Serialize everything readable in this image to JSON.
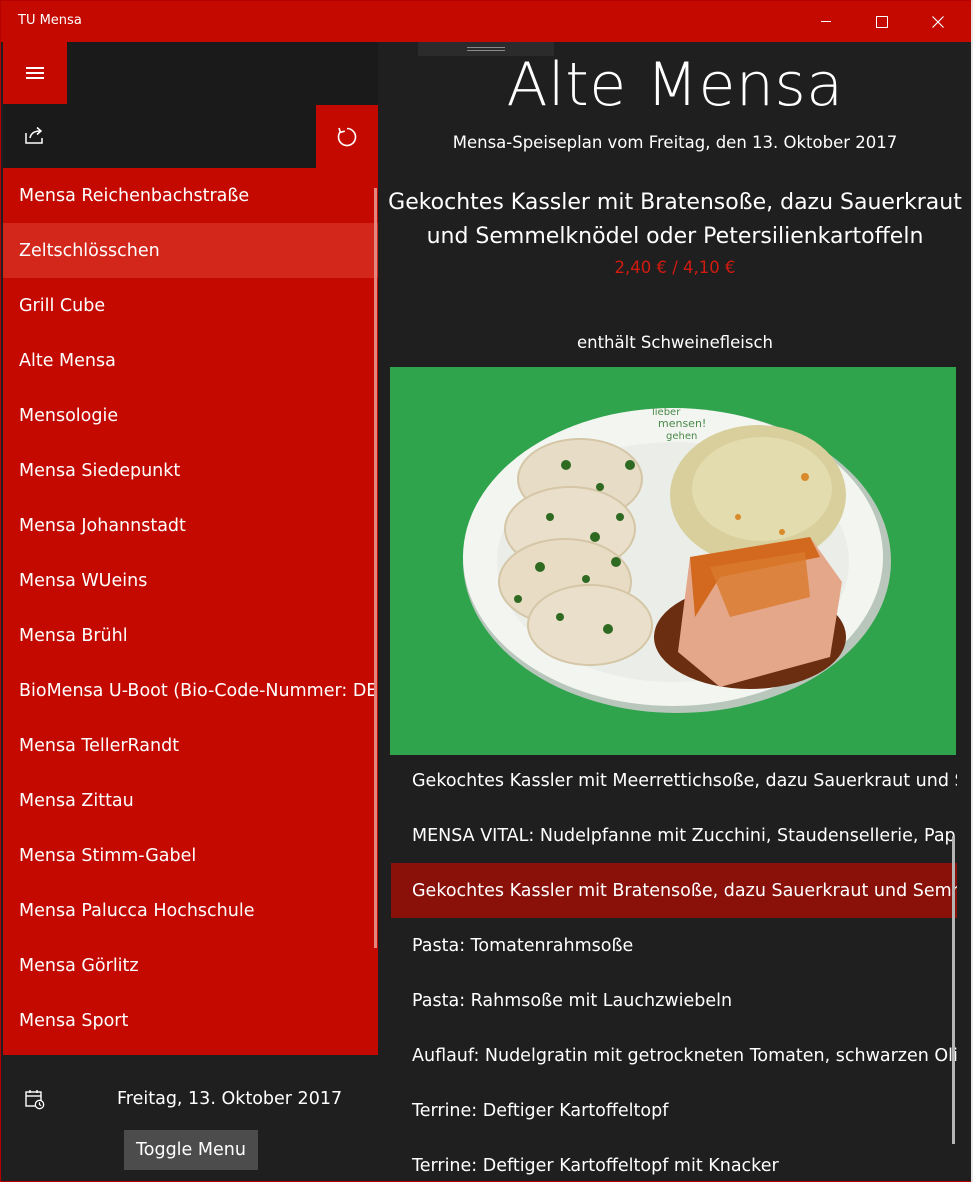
{
  "window": {
    "title": "TU Mensa",
    "accent_color": "#c40a00",
    "controls": [
      "minimize-icon",
      "maximize-icon",
      "close-icon"
    ]
  },
  "pane": {
    "menu_icon": "hamburger-icon",
    "share_icon": "share-icon",
    "refresh_icon": "refresh-icon",
    "mensas": [
      {
        "label": "Mensa Reichenbachstraße",
        "selected": false
      },
      {
        "label": "Zeltschlösschen",
        "selected": true
      },
      {
        "label": "Grill Cube",
        "selected": false
      },
      {
        "label": "Alte Mensa",
        "selected": false
      },
      {
        "label": "Mensologie",
        "selected": false
      },
      {
        "label": "Mensa Siedepunkt",
        "selected": false
      },
      {
        "label": "Mensa Johannstadt",
        "selected": false
      },
      {
        "label": "Mensa WUeins",
        "selected": false
      },
      {
        "label": "Mensa Brühl",
        "selected": false
      },
      {
        "label": "BioMensa U-Boot (Bio-Code-Nummer: DE",
        "selected": false
      },
      {
        "label": "Mensa TellerRandt",
        "selected": false
      },
      {
        "label": "Mensa Zittau",
        "selected": false
      },
      {
        "label": "Mensa Stimm-Gabel",
        "selected": false
      },
      {
        "label": "Mensa Palucca Hochschule",
        "selected": false
      },
      {
        "label": "Mensa Görlitz",
        "selected": false
      },
      {
        "label": "Mensa Sport",
        "selected": false
      }
    ],
    "calendar_icon": "calendar-icon",
    "date": "Freitag, 13. Oktober 2017",
    "toggle_label": "Toggle Menu"
  },
  "content": {
    "mensa_name": "Alte Mensa",
    "subtitle": "Mensa-Speiseplan vom Freitag, den 13. Oktober 2017",
    "dish_title": "Gekochtes Kassler mit Bratensoße, dazu Sauerkraut und Semmelknödel oder Petersilienkartoffeln",
    "price": "2,40 € / 4,10 €",
    "note": "enthält Schweinefleisch",
    "photo_icon": "dish-photo",
    "plate_text": "lieber mensen! gehen",
    "meals": [
      {
        "label": "Gekochtes Kassler mit Meerrettichsoße, dazu Sauerkraut und Semmelknödel",
        "selected": false
      },
      {
        "label": "MENSA VITAL: Nudelpfanne mit Zucchini, Staudensellerie, Paprika",
        "selected": false
      },
      {
        "label": "Gekochtes Kassler mit Bratensoße, dazu Sauerkraut und Semmelknödel",
        "selected": true
      },
      {
        "label": "Pasta: Tomatenrahmsoße",
        "selected": false
      },
      {
        "label": "Pasta: Rahmsoße mit Lauchzwiebeln",
        "selected": false
      },
      {
        "label": "Auflauf: Nudelgratin mit getrockneten Tomaten, schwarzen Oliven",
        "selected": false
      },
      {
        "label": "Terrine: Deftiger Kartoffeltopf",
        "selected": false
      },
      {
        "label": "Terrine: Deftiger Kartoffeltopf mit Knacker",
        "selected": false
      }
    ]
  }
}
